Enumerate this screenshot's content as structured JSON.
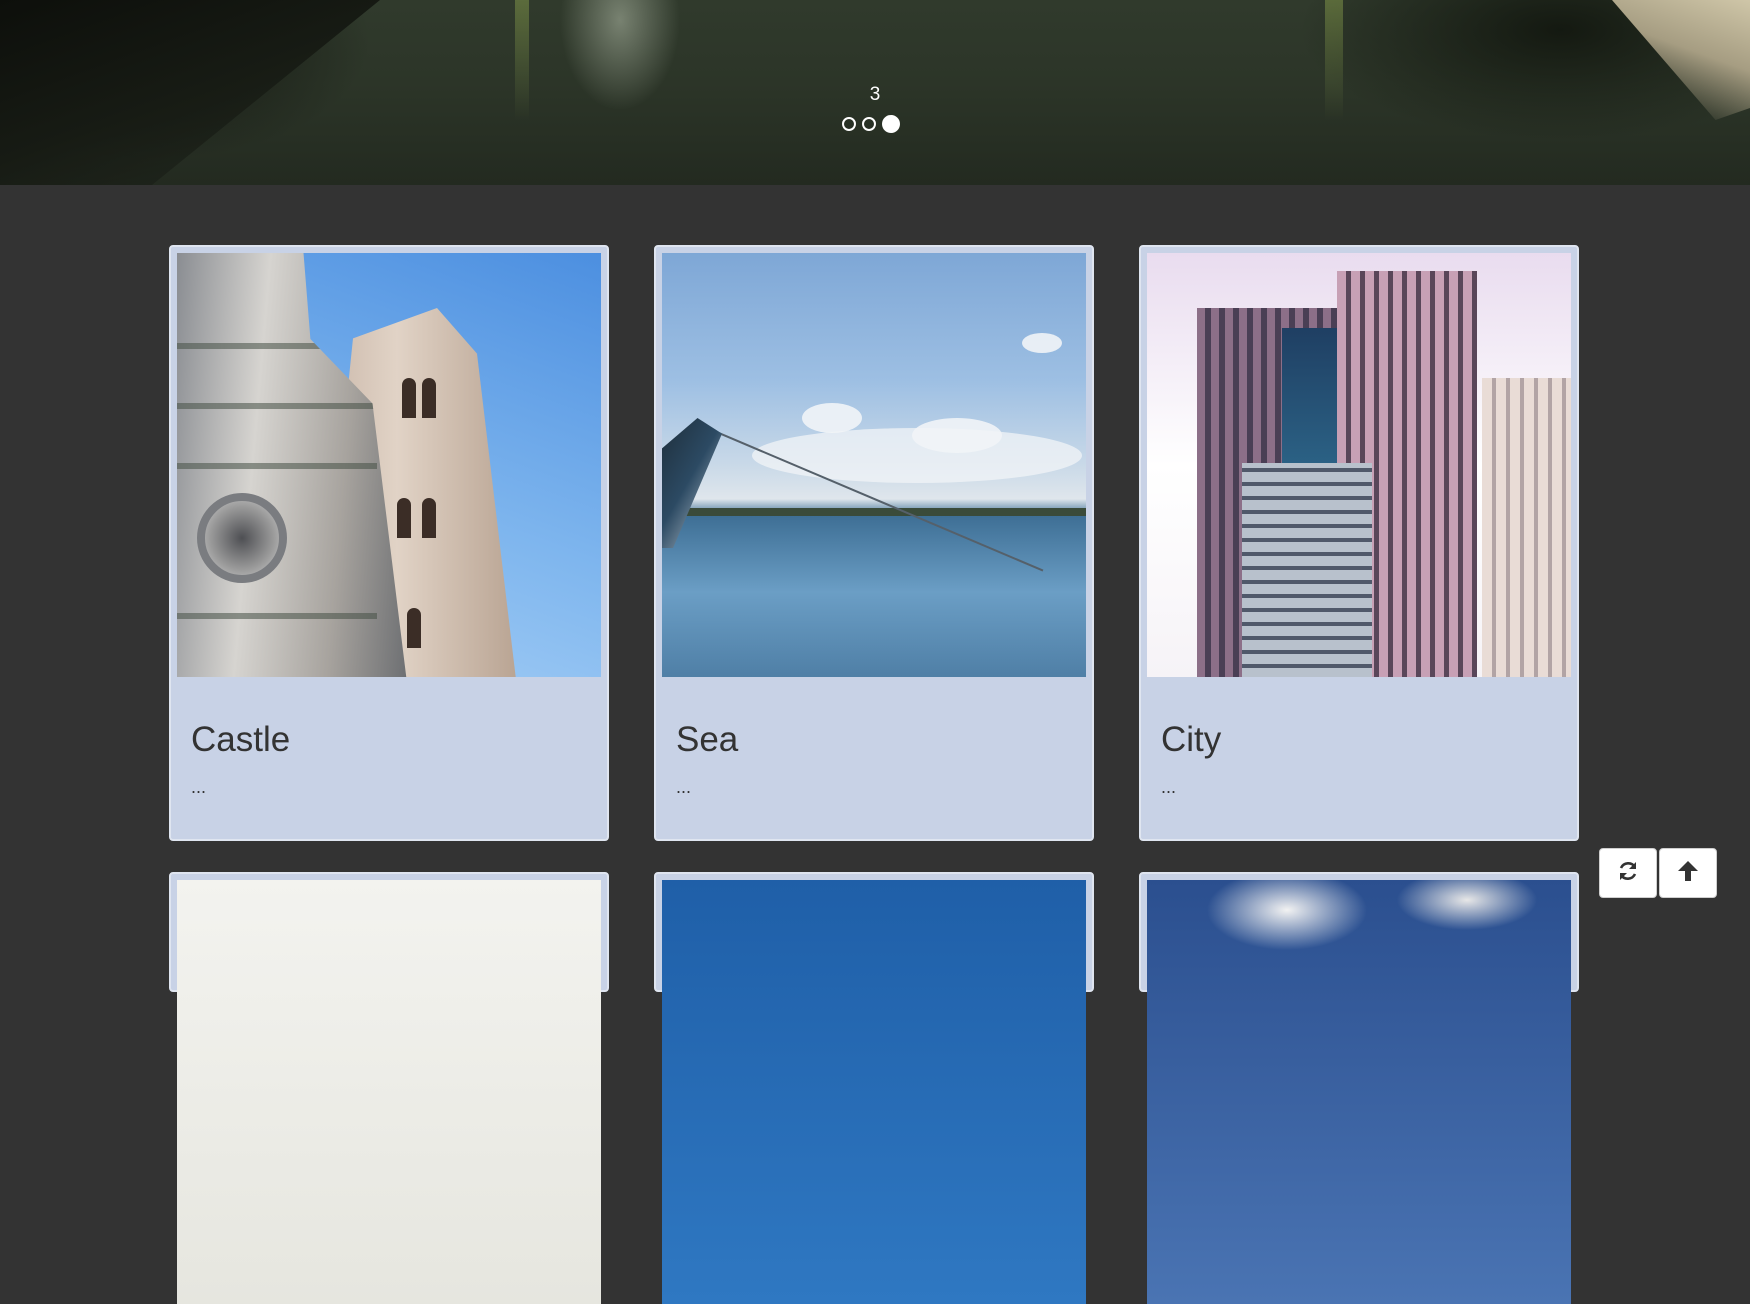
{
  "carousel": {
    "slide_number": "3",
    "slides_count": 3,
    "active_index": 3
  },
  "cards": [
    {
      "title": "Castle",
      "description": "..."
    },
    {
      "title": "Sea",
      "description": "..."
    },
    {
      "title": "City",
      "description": "..."
    }
  ],
  "controls": {
    "refresh_icon": "refresh-icon",
    "scroll_top_icon": "arrow-up-icon"
  },
  "colors": {
    "page_background": "#333333",
    "card_background": "#c8d2e6"
  }
}
